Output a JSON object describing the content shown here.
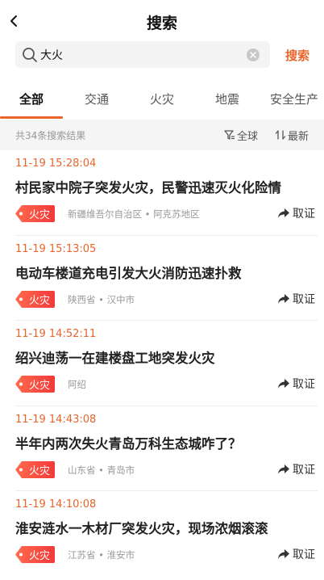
{
  "header": {
    "title": "搜索"
  },
  "search": {
    "value": "大火",
    "button_label": "搜索"
  },
  "tabs": [
    {
      "label": "全部"
    },
    {
      "label": "交通"
    },
    {
      "label": "火灾"
    },
    {
      "label": "地震"
    },
    {
      "label": "安全生产"
    }
  ],
  "filter": {
    "count_text": "共34条搜索结果",
    "region_label": "全球",
    "sort_label": "最新"
  },
  "items": [
    {
      "time": "11-19 15:28:04",
      "title": "村民家中院子突发火灾，民警迅速灭火化险情",
      "tag": "火灾",
      "province": "新疆维吾尔自治区",
      "city": "阿克苏地区",
      "report_label": "取证"
    },
    {
      "time": "11-19 15:13:05",
      "title": "电动车楼道充电引发大火消防迅速扑救",
      "tag": "火灾",
      "province": "陕西省",
      "city": "汉中市",
      "report_label": "取证"
    },
    {
      "time": "11-19 14:52:11",
      "title": "绍兴迪荡一在建楼盘工地突发火灾",
      "tag": "火灾",
      "province": "阿绍",
      "city": "",
      "report_label": "取证"
    },
    {
      "time": "11-19 14:43:08",
      "title": "半年内两次失火青岛万科生态城咋了？",
      "tag": "火灾",
      "province": "山东省",
      "city": "青岛市",
      "report_label": "取证"
    },
    {
      "time": "11-19 14:10:08",
      "title": "淮安涟水一木材厂突发火灾，现场浓烟滚滚",
      "tag": "火灾",
      "province": "江苏省",
      "city": "淮安市",
      "report_label": "取证"
    }
  ],
  "colors": {
    "accent": "#e8652b",
    "tag_gradient_start": "#ff6a4d",
    "tag_gradient_end": "#f23a3a"
  }
}
